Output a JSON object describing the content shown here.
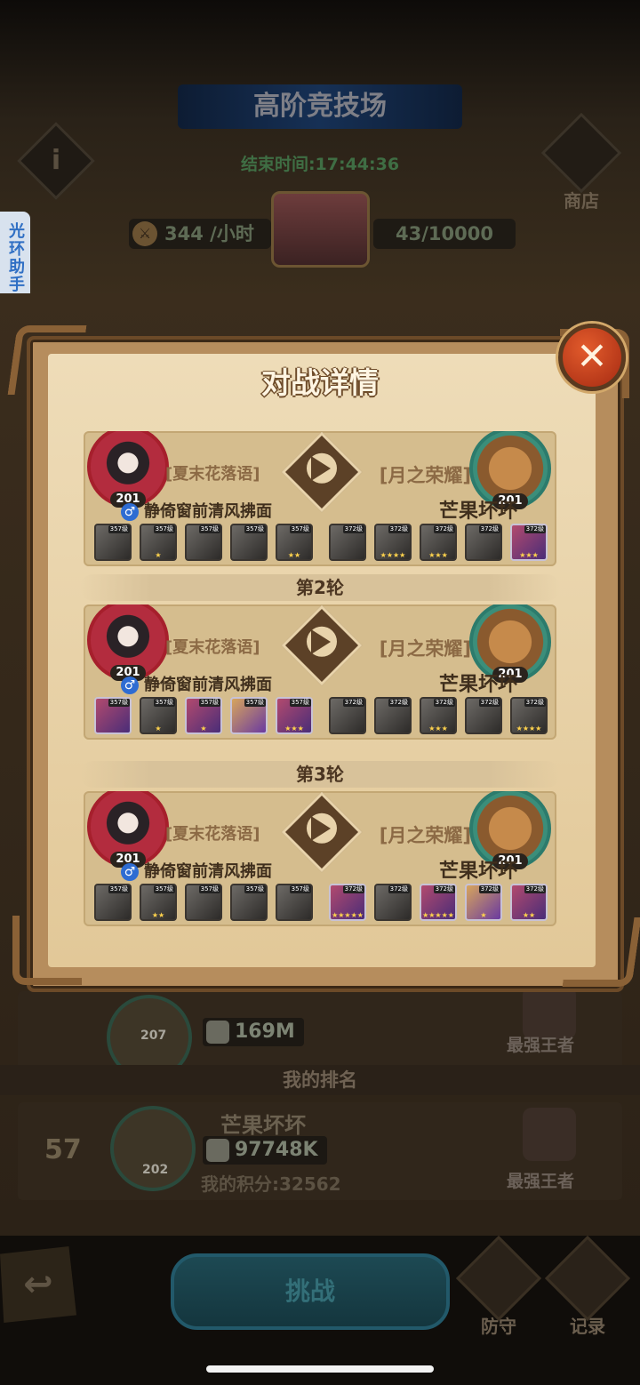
{
  "background": {
    "title": "高阶竞技场",
    "end_time": "结束时间:17:44:36",
    "shop_label": "商店",
    "rate": "344 /小时",
    "capacity": "43/10000",
    "side_tab": "光环助手",
    "row_power": "169M",
    "row_level": "207",
    "row_rank_label": "最强王者",
    "my_rank_header": "我的排名",
    "my_rank_no": "57",
    "my_name": "芒果坏坏",
    "my_power": "97748K",
    "my_level": "202",
    "my_score": "我的积分:32562",
    "my_rank_label": "最强王者",
    "fight_label": "挑战",
    "defense_label": "防守",
    "record_label": "记录"
  },
  "modal": {
    "title": "对战详情",
    "close_icon": "close-icon",
    "rounds": [
      {
        "label": "",
        "left": {
          "guild": "[夏末花落语]",
          "name": "静倚窗前清风拂面",
          "level": "201",
          "gender": "♂"
        },
        "right": {
          "guild": "[月之荣耀]",
          "name": "芒果坏坏",
          "level": "201"
        },
        "left_heroes": [
          {
            "lvl": "357级",
            "stars": "",
            "active": false
          },
          {
            "lvl": "357级",
            "stars": "★",
            "active": false
          },
          {
            "lvl": "357级",
            "stars": "",
            "active": false
          },
          {
            "lvl": "357级",
            "stars": "",
            "active": false
          },
          {
            "lvl": "357级",
            "stars": "★★",
            "active": false
          }
        ],
        "right_heroes": [
          {
            "lvl": "372级",
            "stars": "",
            "active": false
          },
          {
            "lvl": "372级",
            "stars": "★★★★",
            "active": false
          },
          {
            "lvl": "372级",
            "stars": "★★★",
            "active": false
          },
          {
            "lvl": "372级",
            "stars": "",
            "active": false
          },
          {
            "lvl": "372级",
            "stars": "★★★",
            "active": true
          }
        ]
      },
      {
        "label": "第2轮",
        "left": {
          "guild": "[夏末花落语]",
          "name": "静倚窗前清风拂面",
          "level": "201",
          "gender": "♂"
        },
        "right": {
          "guild": "[月之荣耀]",
          "name": "芒果坏坏",
          "level": "201"
        },
        "left_heroes": [
          {
            "lvl": "357级",
            "stars": "",
            "active": true
          },
          {
            "lvl": "357级",
            "stars": "★",
            "active": false
          },
          {
            "lvl": "357级",
            "stars": "★",
            "active": true
          },
          {
            "lvl": "357级",
            "stars": "",
            "active": true
          },
          {
            "lvl": "357级",
            "stars": "★★★",
            "active": true
          }
        ],
        "right_heroes": [
          {
            "lvl": "372级",
            "stars": "",
            "active": false
          },
          {
            "lvl": "372级",
            "stars": "",
            "active": false
          },
          {
            "lvl": "372级",
            "stars": "★★★",
            "active": false
          },
          {
            "lvl": "372级",
            "stars": "",
            "active": false
          },
          {
            "lvl": "372级",
            "stars": "★★★★",
            "active": false
          }
        ]
      },
      {
        "label": "第3轮",
        "left": {
          "guild": "[夏末花落语]",
          "name": "静倚窗前清风拂面",
          "level": "201",
          "gender": "♂"
        },
        "right": {
          "guild": "[月之荣耀]",
          "name": "芒果坏坏",
          "level": "201"
        },
        "left_heroes": [
          {
            "lvl": "357级",
            "stars": "",
            "active": false
          },
          {
            "lvl": "357级",
            "stars": "★★",
            "active": false
          },
          {
            "lvl": "357级",
            "stars": "",
            "active": false
          },
          {
            "lvl": "357级",
            "stars": "",
            "active": false
          },
          {
            "lvl": "357级",
            "stars": "",
            "active": false
          }
        ],
        "right_heroes": [
          {
            "lvl": "372级",
            "stars": "★★★★★",
            "active": true
          },
          {
            "lvl": "372级",
            "stars": "",
            "active": false
          },
          {
            "lvl": "372级",
            "stars": "★★★★★",
            "active": true
          },
          {
            "lvl": "372级",
            "stars": "★",
            "active": true
          },
          {
            "lvl": "372级",
            "stars": "★★",
            "active": true
          }
        ]
      }
    ]
  }
}
